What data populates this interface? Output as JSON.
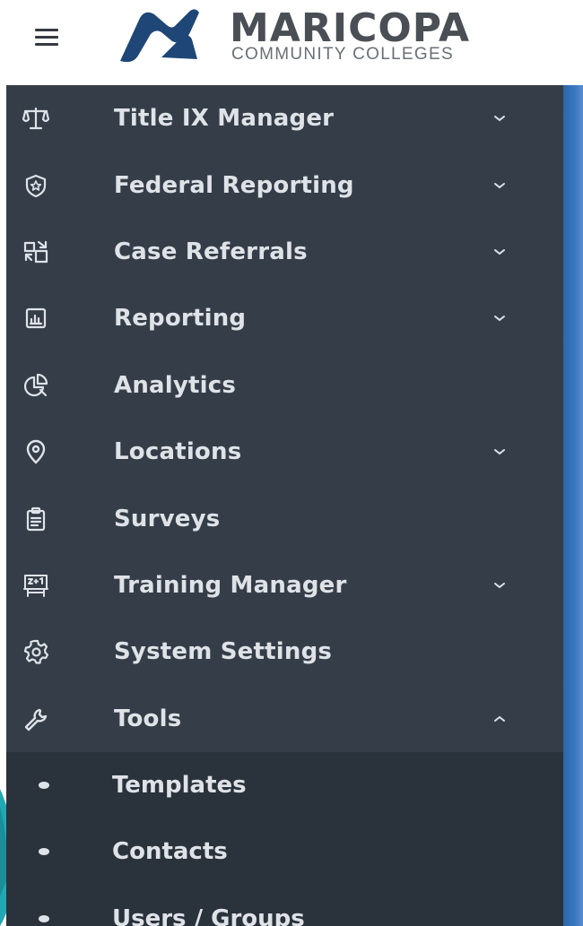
{
  "header": {
    "menu_icon": "hamburger-icon",
    "logo": {
      "name": "MARICOPA",
      "subtitle": "COMMUNITY COLLEGES",
      "brand_color": "#1e4677"
    }
  },
  "sidebar": {
    "background": "#353e48",
    "submenu_background": "#2a323b",
    "items": [
      {
        "label": "Title IX Manager",
        "icon": "scales-icon",
        "expandable": true,
        "expanded": false
      },
      {
        "label": "Federal Reporting",
        "icon": "shield-star-icon",
        "expandable": true,
        "expanded": false
      },
      {
        "label": "Case Referrals",
        "icon": "referral-transfer-icon",
        "expandable": true,
        "expanded": false
      },
      {
        "label": "Reporting",
        "icon": "report-chart-icon",
        "expandable": true,
        "expanded": false
      },
      {
        "label": "Analytics",
        "icon": "pie-chart-icon",
        "expandable": false,
        "expanded": false
      },
      {
        "label": "Locations",
        "icon": "map-pin-icon",
        "expandable": true,
        "expanded": false
      },
      {
        "label": "Surveys",
        "icon": "clipboard-icon",
        "expandable": false,
        "expanded": false
      },
      {
        "label": "Training Manager",
        "icon": "training-board-icon",
        "expandable": true,
        "expanded": false
      },
      {
        "label": "System Settings",
        "icon": "gear-icon",
        "expandable": false,
        "expanded": false
      },
      {
        "label": "Tools",
        "icon": "wrench-icon",
        "expandable": true,
        "expanded": true
      }
    ],
    "tools_submenu": [
      {
        "label": "Templates"
      },
      {
        "label": "Contacts"
      },
      {
        "label": "Users / Groups"
      }
    ]
  }
}
